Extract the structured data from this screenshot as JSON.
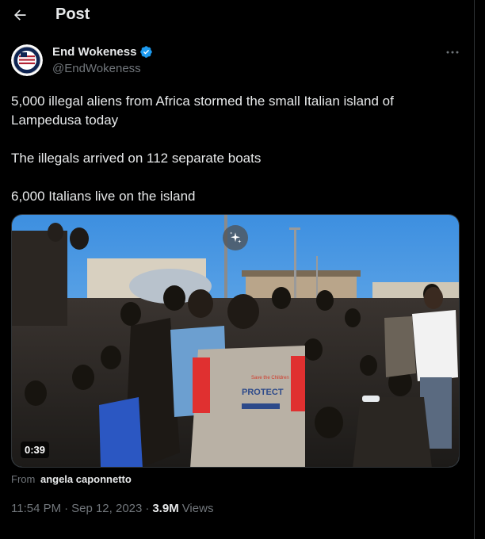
{
  "header": {
    "title": "Post"
  },
  "author": {
    "display_name": "End Wokeness",
    "handle": "@EndWokeness",
    "verified": true
  },
  "tweet": {
    "lines": [
      "5,000 illegal aliens from Africa stormed the small Italian island of Lampedusa today",
      "The illegals arrived on 112 separate boats",
      "6,000 Italians live on the island"
    ]
  },
  "media": {
    "type": "video",
    "duration": "0:39",
    "vest_text_top": "Save the Children",
    "vest_text_main": "PROTECT"
  },
  "source": {
    "prefix": "From",
    "name": "angela caponnetto"
  },
  "meta": {
    "time": "11:54 PM",
    "separator": "·",
    "date": "Sep 12, 2023",
    "views_count": "3.9M",
    "views_label": "Views"
  },
  "colors": {
    "background": "#000000",
    "text": "#e7e9ea",
    "secondary": "#71767b",
    "verified": "#1d9bf0",
    "border": "#2f3336"
  }
}
